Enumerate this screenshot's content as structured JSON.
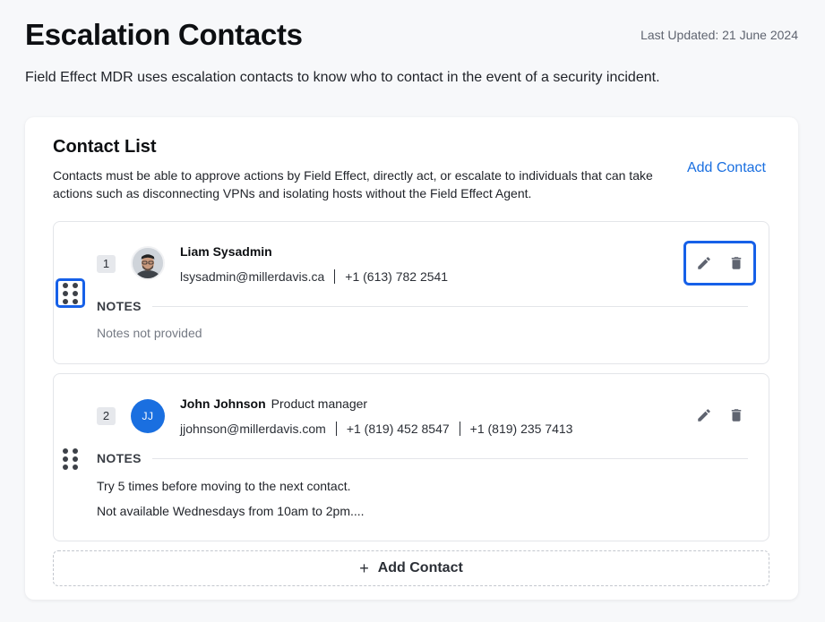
{
  "header": {
    "title": "Escalation Contacts",
    "last_updated": "Last Updated: 21 June 2024",
    "description": "Field Effect MDR uses escalation contacts to know who to contact in the event of a security incident."
  },
  "contact_list": {
    "title": "Contact List",
    "description": "Contacts must be able to approve actions by Field Effect, directly act, or escalate to individuals that can take actions such as disconnecting VPNs and isolating hosts without the Field Effect Agent.",
    "add_contact_link": "Add Contact",
    "add_contact_button": "Add Contact",
    "contacts": [
      {
        "index": "1",
        "name": "Liam Sysadmin",
        "role": "",
        "email": "lsysadmin@millerdavis.ca",
        "phone1": "+1 (613) 782 2541",
        "phone2": "",
        "notes_label": "NOTES",
        "notes": [
          "Notes not provided"
        ]
      },
      {
        "index": "2",
        "name": "John Johnson",
        "role": "Product manager",
        "initials": "JJ",
        "email": "jjohnson@millerdavis.com",
        "phone1": "+1 (819) 452 8547",
        "phone2": "+1 (819) 235 7413",
        "notes_label": "NOTES",
        "notes": [
          "Try 5 times before moving to the next contact.",
          "Not available Wednesdays from 10am to 2pm...."
        ]
      }
    ]
  },
  "colors": {
    "accent": "#1a6fe0",
    "highlight": "#1660e8",
    "avatar_bg": "#1a6fe0"
  },
  "icons": {
    "drag": "drag-handle-icon",
    "edit": "pencil-icon",
    "delete": "trash-icon",
    "add": "plus-icon"
  }
}
